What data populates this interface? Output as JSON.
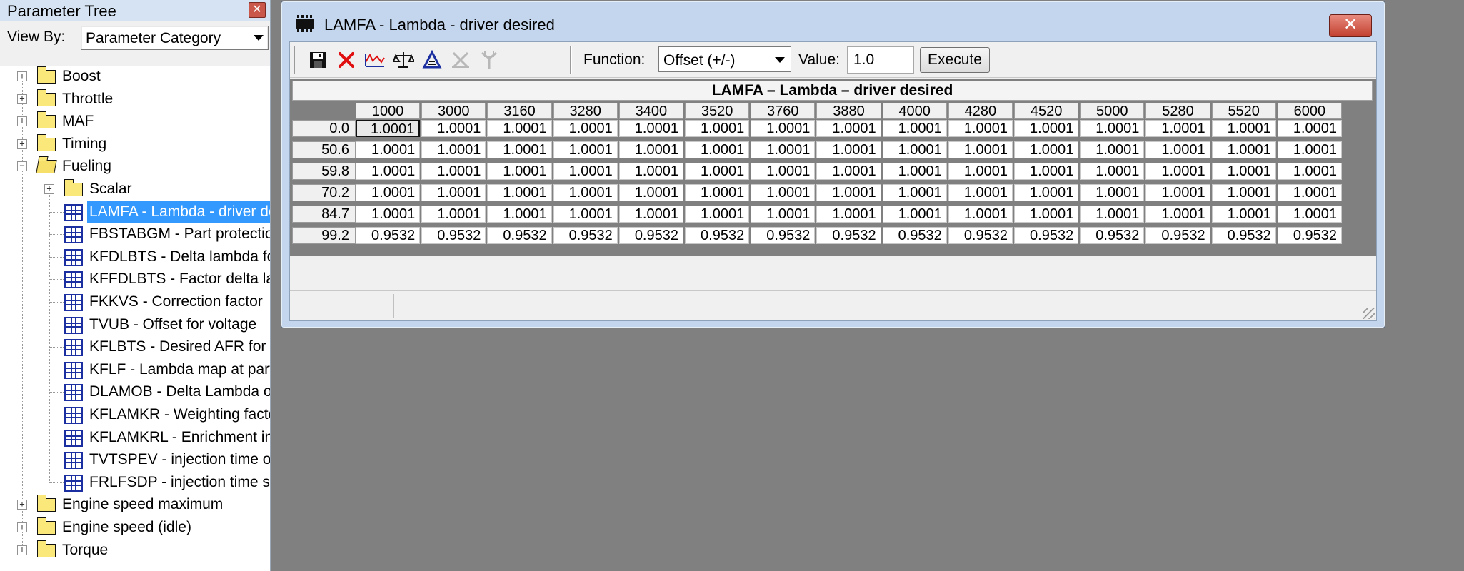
{
  "tree_panel": {
    "title": "Parameter Tree",
    "close_glyph": "✕",
    "view_by_label": "View By:",
    "view_by_value": "Parameter Category",
    "items": [
      {
        "label": "Boost",
        "type": "folder",
        "expander": "+"
      },
      {
        "label": "Throttle",
        "type": "folder",
        "expander": "+"
      },
      {
        "label": "MAF",
        "type": "folder",
        "expander": "+"
      },
      {
        "label": "Timing",
        "type": "folder",
        "expander": "+"
      },
      {
        "label": "Fueling",
        "type": "folder-open",
        "expander": "−"
      },
      {
        "label": "Scalar",
        "type": "folder",
        "expander": "+"
      },
      {
        "label": "LAMFA - Lambda - driver desired",
        "type": "table",
        "selected": true
      },
      {
        "label": "FBSTABGM - Part protection",
        "type": "table"
      },
      {
        "label": "KFDLBTS - Delta lambda for",
        "type": "table"
      },
      {
        "label": "KFFDLBTS - Factor delta lambda",
        "type": "table"
      },
      {
        "label": "FKKVS - Correction factor",
        "type": "table"
      },
      {
        "label": "TVUB - Offset for voltage",
        "type": "table"
      },
      {
        "label": "KFLBTS - Desired AFR for",
        "type": "table"
      },
      {
        "label": "KFLF - Lambda map at part",
        "type": "table"
      },
      {
        "label": "DLAMOB - Delta Lambda on",
        "type": "table"
      },
      {
        "label": "KFLAMKR - Weighting factor",
        "type": "table"
      },
      {
        "label": "KFLAMKRL - Enrichment in",
        "type": "table"
      },
      {
        "label": "TVTSPEV -  injection time on",
        "type": "table"
      },
      {
        "label": "FRLFSDP - injection time scale",
        "type": "table"
      },
      {
        "label": "Engine speed maximum",
        "type": "folder",
        "expander": "+"
      },
      {
        "label": "Engine speed (idle)",
        "type": "folder",
        "expander": "+"
      },
      {
        "label": "Torque",
        "type": "folder",
        "expander": "+"
      }
    ]
  },
  "table_window": {
    "title": "LAMFA - Lambda - driver desired",
    "close_glyph": "✕",
    "toolbar": {
      "icons": [
        "save-icon",
        "delete-icon",
        "graph-icon",
        "scale-icon",
        "interpolate-icon",
        "flip-x-icon",
        "flip-y-icon"
      ],
      "function_label": "Function:",
      "function_value": "Offset (+/-)",
      "value_label": "Value:",
      "value_input": "1.0",
      "execute_label": "Execute"
    },
    "grid": {
      "title": "LAMFA – Lambda – driver desired",
      "columns": [
        "1000",
        "3000",
        "3160",
        "3280",
        "3400",
        "3520",
        "3760",
        "3880",
        "4000",
        "4280",
        "4520",
        "5000",
        "5280",
        "5520",
        "6000"
      ],
      "rows": [
        {
          "header": "0.0",
          "values": [
            "1.0001",
            "1.0001",
            "1.0001",
            "1.0001",
            "1.0001",
            "1.0001",
            "1.0001",
            "1.0001",
            "1.0001",
            "1.0001",
            "1.0001",
            "1.0001",
            "1.0001",
            "1.0001",
            "1.0001"
          ]
        },
        {
          "header": "50.6",
          "values": [
            "1.0001",
            "1.0001",
            "1.0001",
            "1.0001",
            "1.0001",
            "1.0001",
            "1.0001",
            "1.0001",
            "1.0001",
            "1.0001",
            "1.0001",
            "1.0001",
            "1.0001",
            "1.0001",
            "1.0001"
          ]
        },
        {
          "header": "59.8",
          "values": [
            "1.0001",
            "1.0001",
            "1.0001",
            "1.0001",
            "1.0001",
            "1.0001",
            "1.0001",
            "1.0001",
            "1.0001",
            "1.0001",
            "1.0001",
            "1.0001",
            "1.0001",
            "1.0001",
            "1.0001"
          ]
        },
        {
          "header": "70.2",
          "values": [
            "1.0001",
            "1.0001",
            "1.0001",
            "1.0001",
            "1.0001",
            "1.0001",
            "1.0001",
            "1.0001",
            "1.0001",
            "1.0001",
            "1.0001",
            "1.0001",
            "1.0001",
            "1.0001",
            "1.0001"
          ]
        },
        {
          "header": "84.7",
          "values": [
            "1.0001",
            "1.0001",
            "1.0001",
            "1.0001",
            "1.0001",
            "1.0001",
            "1.0001",
            "1.0001",
            "1.0001",
            "1.0001",
            "1.0001",
            "1.0001",
            "1.0001",
            "1.0001",
            "1.0001"
          ]
        },
        {
          "header": "99.2",
          "values": [
            "0.9532",
            "0.9532",
            "0.9532",
            "0.9532",
            "0.9532",
            "0.9532",
            "0.9532",
            "0.9532",
            "0.9532",
            "0.9532",
            "0.9532",
            "0.9532",
            "0.9532",
            "0.9532",
            "0.9532"
          ]
        }
      ]
    }
  },
  "colors": {
    "desktop": "#808080",
    "selection": "#3399ff",
    "window_frame": "#c3d6ed",
    "close_button": "#c2402f",
    "grid_icon": "#1c2fa0",
    "folder": "#fbe87a"
  }
}
